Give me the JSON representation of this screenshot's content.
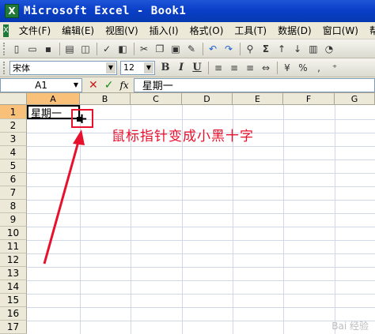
{
  "window": {
    "title": "Microsoft Excel - Book1",
    "app_icon": "X"
  },
  "menu": {
    "items": [
      "文件(F)",
      "编辑(E)",
      "视图(V)",
      "插入(I)",
      "格式(O)",
      "工具(T)",
      "数据(D)",
      "窗口(W)",
      "帮助"
    ]
  },
  "toolbar_format": {
    "font_name": "宋体",
    "font_size": "12",
    "bold": "B",
    "italic": "I",
    "underline": "U"
  },
  "formula_bar": {
    "cell_ref": "A1",
    "cancel": "✕",
    "enter": "✓",
    "fx": "fx",
    "content": "星期一"
  },
  "sheet": {
    "columns": [
      "A",
      "B",
      "C",
      "D",
      "E",
      "F",
      "G"
    ],
    "rows": [
      "1",
      "2",
      "3",
      "4",
      "5",
      "6",
      "7",
      "8",
      "9",
      "10",
      "11",
      "12",
      "13",
      "14",
      "15",
      "16",
      "17"
    ],
    "a1_value": "星期一",
    "cursor_glyph": "+"
  },
  "annotation": {
    "text": "鼠标指针变成小黑十字",
    "color": "#e8112d"
  },
  "watermark": {
    "text": "Bai 经验"
  }
}
